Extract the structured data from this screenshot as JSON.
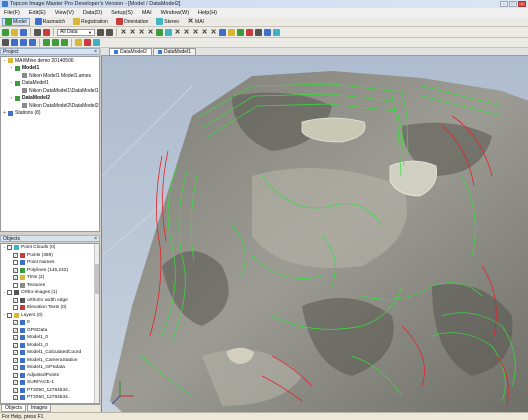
{
  "window": {
    "title": "Topcon Image Master Pro Developer's Version - [Model / DataModel2]"
  },
  "menu": [
    "File(F)",
    "Edit(E)",
    "View(V)",
    "Data(D)",
    "Setup(S)",
    "MAI",
    "Window(W)",
    "Help(H)"
  ],
  "toolbar1": {
    "model": "Model",
    "rasmatch": "Rasmatch",
    "registration": "Registration",
    "orientation": "Orientation",
    "stereo": "Stereo",
    "mai": "MAI"
  },
  "toolbar2": {
    "layer_value": "All Data"
  },
  "doc_tabs": [
    "DataModel2",
    "DataModel1"
  ],
  "project": {
    "header": "Project",
    "items": [
      {
        "label": "MAI\\Mine demo 20140506",
        "level": 0,
        "exp": "-",
        "color": "#d8b636",
        "bold": false
      },
      {
        "label": "Model1",
        "level": 1,
        "exp": "-",
        "color": "#3d9c3d",
        "bold": true
      },
      {
        "label": "Nikon Model1 Model1.ames",
        "level": 2,
        "exp": "",
        "color": "#8a8a8a",
        "bold": false
      },
      {
        "label": "DataModel1",
        "level": 1,
        "exp": "-",
        "color": "#3d9c3d",
        "bold": false
      },
      {
        "label": "Nikon DataModel1\\DataModel1",
        "level": 2,
        "exp": "",
        "color": "#8a8a8a",
        "bold": false
      },
      {
        "label": "DataModel2",
        "level": 1,
        "exp": "-",
        "color": "#3d9c3d",
        "bold": true
      },
      {
        "label": "Nikon DataModel2\\DataModel2",
        "level": 2,
        "exp": "",
        "color": "#8a8a8a",
        "bold": false
      },
      {
        "label": "Stations (8)",
        "level": 0,
        "exp": "+",
        "color": "#3f6fc9",
        "bold": false
      }
    ]
  },
  "objects": {
    "header": "Objects",
    "items": [
      {
        "label": "Point Clouds (0)",
        "level": 0,
        "exp": "-",
        "checked": false,
        "color": "#3fb3c4"
      },
      {
        "label": "Points (389)",
        "level": 1,
        "exp": "",
        "checked": true,
        "color": "#c93c3c"
      },
      {
        "label": "Point Names",
        "level": 1,
        "exp": "",
        "checked": false,
        "color": "#3f6fc9"
      },
      {
        "label": "Polylines (145,242)",
        "level": 1,
        "exp": "",
        "checked": true,
        "color": "#3d9c3d"
      },
      {
        "label": "TINs (2)",
        "level": 1,
        "exp": "",
        "checked": true,
        "color": "#d8b636"
      },
      {
        "label": "Textures",
        "level": 1,
        "exp": "",
        "checked": false,
        "color": "#8a8a8a"
      },
      {
        "label": "Ortho-images (1)",
        "level": 0,
        "exp": "-",
        "checked": false,
        "color": "#555555"
      },
      {
        "label": "ortho01 width edge",
        "level": 1,
        "exp": "",
        "checked": true,
        "color": "#555555"
      },
      {
        "label": "Elevation Texts (0)",
        "level": 1,
        "exp": "",
        "checked": false,
        "color": "#c93c3c"
      },
      {
        "label": "Layers (0)",
        "level": 0,
        "exp": "-",
        "checked": false,
        "color": "#d8b636"
      },
      {
        "label": "0",
        "level": 1,
        "exp": "",
        "checked": true,
        "color": "#3f6fc9"
      },
      {
        "label": "GPSData",
        "level": 1,
        "exp": "",
        "checked": true,
        "color": "#3f6fc9"
      },
      {
        "label": "Model1_0",
        "level": 1,
        "exp": "",
        "checked": true,
        "color": "#3f6fc9"
      },
      {
        "label": "Model1_0",
        "level": 1,
        "exp": "",
        "checked": true,
        "color": "#3f6fc9"
      },
      {
        "label": "Model1_CalculatedCoord",
        "level": 1,
        "exp": "",
        "checked": true,
        "color": "#3f6fc9"
      },
      {
        "label": "Model1_CameraStation",
        "level": 1,
        "exp": "",
        "checked": true,
        "color": "#3f6fc9"
      },
      {
        "label": "Model1_GPSdata",
        "level": 1,
        "exp": "",
        "checked": true,
        "color": "#3f6fc9"
      },
      {
        "label": "AdjustedPoints",
        "level": 1,
        "exp": "",
        "checked": true,
        "color": "#3f6fc9"
      },
      {
        "label": "SURFACE-1",
        "level": 1,
        "exp": "",
        "checked": true,
        "color": "#3f6fc9"
      },
      {
        "label": "PT2050_12784534..",
        "level": 1,
        "exp": "",
        "checked": true,
        "color": "#3f6fc9"
      },
      {
        "label": "PT2050_12784534..",
        "level": 1,
        "exp": "",
        "checked": true,
        "color": "#3f6fc9"
      },
      {
        "label": "PT2050_12784534..",
        "level": 1,
        "exp": "",
        "checked": true,
        "color": "#3f6fc9"
      }
    ]
  },
  "bottom_tabs": [
    "Objects",
    "Images"
  ],
  "status": "For Help, press F1",
  "colors": {
    "contour_green": "#34e03a",
    "contour_red": "#e0262a",
    "pit_floor": "#9a9a90",
    "sky": "#b8c6d6"
  }
}
